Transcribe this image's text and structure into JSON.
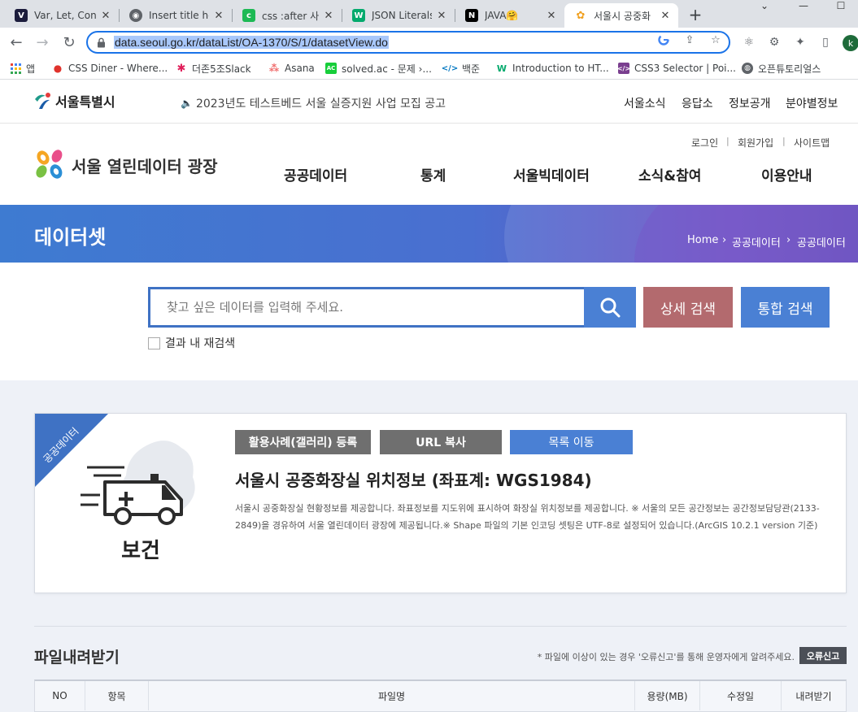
{
  "browser": {
    "tabs": [
      {
        "title": "Var, Let, Cons",
        "favicon_color": "#1c1c3c",
        "favicon_glyph": "V"
      },
      {
        "title": "Insert title he",
        "favicon_color": "#5f6368",
        "favicon_glyph": "◉"
      },
      {
        "title": "css :after 사용",
        "favicon_color": "#1db954",
        "favicon_glyph": "c"
      },
      {
        "title": "JSON Literals",
        "favicon_color": "#04aa6d",
        "favicon_glyph": "W"
      },
      {
        "title": "JAVA🤗",
        "favicon_color": "#000000",
        "favicon_glyph": "N"
      },
      {
        "title": "서울시 공중화",
        "favicon_color": "#f0a020",
        "favicon_glyph": "✿"
      }
    ],
    "url": "data.seoul.go.kr/dataList/OA-1370/S/1/datasetView.do",
    "profile_initial": "k",
    "bookmarks": [
      {
        "label": "앱",
        "icon": "apps-grid-icon"
      },
      {
        "label": "CSS Diner - Where...",
        "icon": "css-diner-icon"
      },
      {
        "label": "더존5조Slack",
        "icon": "slack-icon"
      },
      {
        "label": "Asana",
        "icon": "asana-icon"
      },
      {
        "label": "solved.ac - 문제 ›...",
        "icon": "solvedac-icon"
      },
      {
        "label": "백준",
        "icon": "baekjoon-icon"
      },
      {
        "label": "Introduction to HT...",
        "icon": "w3schools-icon"
      },
      {
        "label": "CSS3 Selector | Poi...",
        "icon": "css3-selector-icon"
      },
      {
        "label": "오픈튜토리얼스",
        "icon": "globe-icon"
      }
    ]
  },
  "topbar": {
    "logo_text": "서울특별시",
    "notice": "2023년도 테스트베드 서울 실증지원 사업 모집 공고",
    "links": [
      "서울소식",
      "응답소",
      "정보공개",
      "분야별정보"
    ]
  },
  "header": {
    "brand": "서울 열린데이터 광장",
    "util_links": [
      "로그인",
      "회원가입",
      "사이트맵"
    ],
    "util_sep": "|",
    "gnb": [
      "공공데이터",
      "통계",
      "서울빅데이터",
      "소식&참여",
      "이용안내"
    ]
  },
  "banner": {
    "title": "데이터셋",
    "breadcrumb": [
      "Home",
      "공공데이터",
      "공공데이터"
    ],
    "crumb_sep": "›"
  },
  "search": {
    "placeholder": "찾고 싶은 데이터를 입력해 주세요.",
    "detail_label": "상세 검색",
    "total_label": "통합 검색",
    "research_label": "결과 내 재검색"
  },
  "dataset": {
    "ribbon": "공공데이터",
    "category": "보건",
    "buttons": {
      "gallery": "활용사례(갤러리) 등록",
      "copy_url": "URL 복사",
      "list": "목록 이동"
    },
    "title": "서울시 공중화장실 위치정보 (좌표계: WGS1984)",
    "description": "서울시 공중화장실 현황정보를 제공합니다. 좌표정보를 지도위에 표시하여 화장실 위치정보를 제공합니다. ※ 서울의 모든 공간정보는 공간정보담당관(2133-2849)을 경유하여 서울 열린데이터 광장에 제공됩니다.※ Shape 파일의 기본 인코딩 셋팅은 UTF-8로 설정되어 있습니다.(ArcGIS 10.2.1 version 기준)"
  },
  "downloads": {
    "title": "파일내려받기",
    "note": "* 파일에 이상이 있는 경우 '오류신고'를 통해 운영자에게 알려주세요.",
    "report_label": "오류신고",
    "columns": [
      "NO",
      "항목",
      "파일명",
      "용량(MB)",
      "수정일",
      "내려받기"
    ]
  },
  "colors": {
    "accent_blue": "#4a80d4",
    "detail_red": "#b36a6e",
    "btn_gray": "#6f6f6f",
    "btn_dark": "#555555"
  }
}
